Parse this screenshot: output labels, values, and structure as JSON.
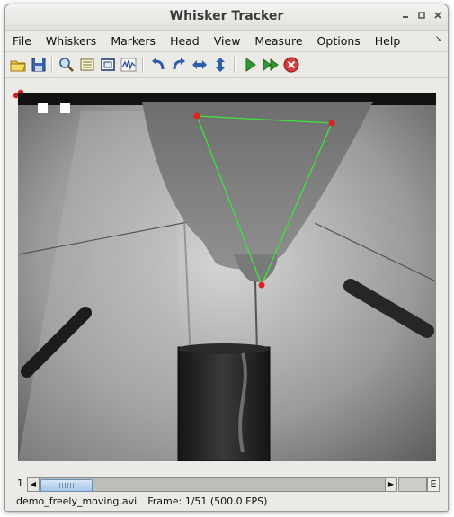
{
  "window": {
    "title": "Whisker Tracker"
  },
  "title_buttons": [
    {
      "name": "minimize-button",
      "glyph": "▫"
    },
    {
      "name": "maximize-button",
      "glyph": "▫"
    },
    {
      "name": "close-button",
      "glyph": "✕"
    }
  ],
  "menu": {
    "items": [
      "File",
      "Whiskers",
      "Markers",
      "Head",
      "View",
      "Measure",
      "Options",
      "Help"
    ],
    "corner_glyph": "↘"
  },
  "toolbar": {
    "icons": [
      "open-folder-icon",
      "save-icon",
      "zoom-icon",
      "panel-icon",
      "frame-icon",
      "waveform-icon",
      "rotate-left-icon",
      "rotate-right-icon",
      "flip-horizontal-icon",
      "flip-vertical-icon",
      "play-icon",
      "fast-forward-icon",
      "stop-icon"
    ]
  },
  "video": {
    "head_markers": [
      {
        "label": "left-eye-marker"
      },
      {
        "label": "right-eye-marker"
      },
      {
        "label": "nose-marker"
      }
    ],
    "triangle_color": "#39e639",
    "marker_color": "#e62020"
  },
  "scrollbar": {
    "frame_label": "1",
    "end_label": "E"
  },
  "status": {
    "filename": "demo_freely_moving.avi",
    "frame_info": "Frame: 1/51 (500.0 FPS)"
  },
  "colors": {
    "window_bg": "#eceae6",
    "video_bg": "#1a1a1a",
    "thumb": "#a8c6e6"
  }
}
